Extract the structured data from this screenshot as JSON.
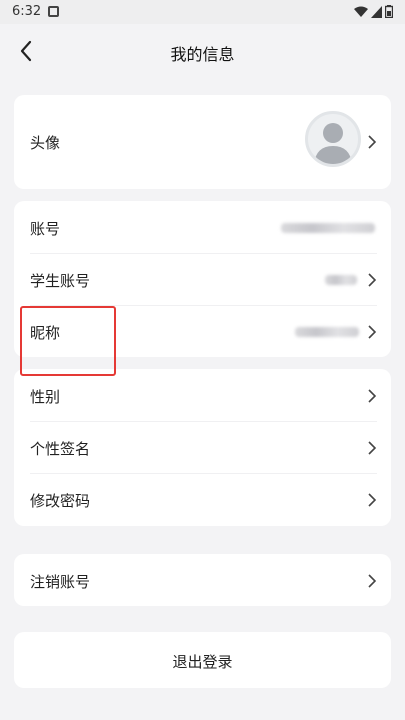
{
  "status_bar": {
    "time": "6:32"
  },
  "header": {
    "title": "我的信息"
  },
  "profile": {
    "avatar_label": "头像",
    "account_label": "账号",
    "student_account_label": "学生账号",
    "nickname_label": "昵称",
    "gender_label": "性别",
    "signature_label": "个性签名",
    "change_password_label": "修改密码",
    "cancel_account_label": "注销账号"
  },
  "logout": {
    "label": "退出登录"
  },
  "colors": {
    "highlight": "#e53935",
    "background": "#f3f3f5"
  },
  "icons": [
    "back-arrow-icon",
    "chevron-right-icon",
    "wifi-icon",
    "signal-icon",
    "battery-icon",
    "notification-icon"
  ]
}
